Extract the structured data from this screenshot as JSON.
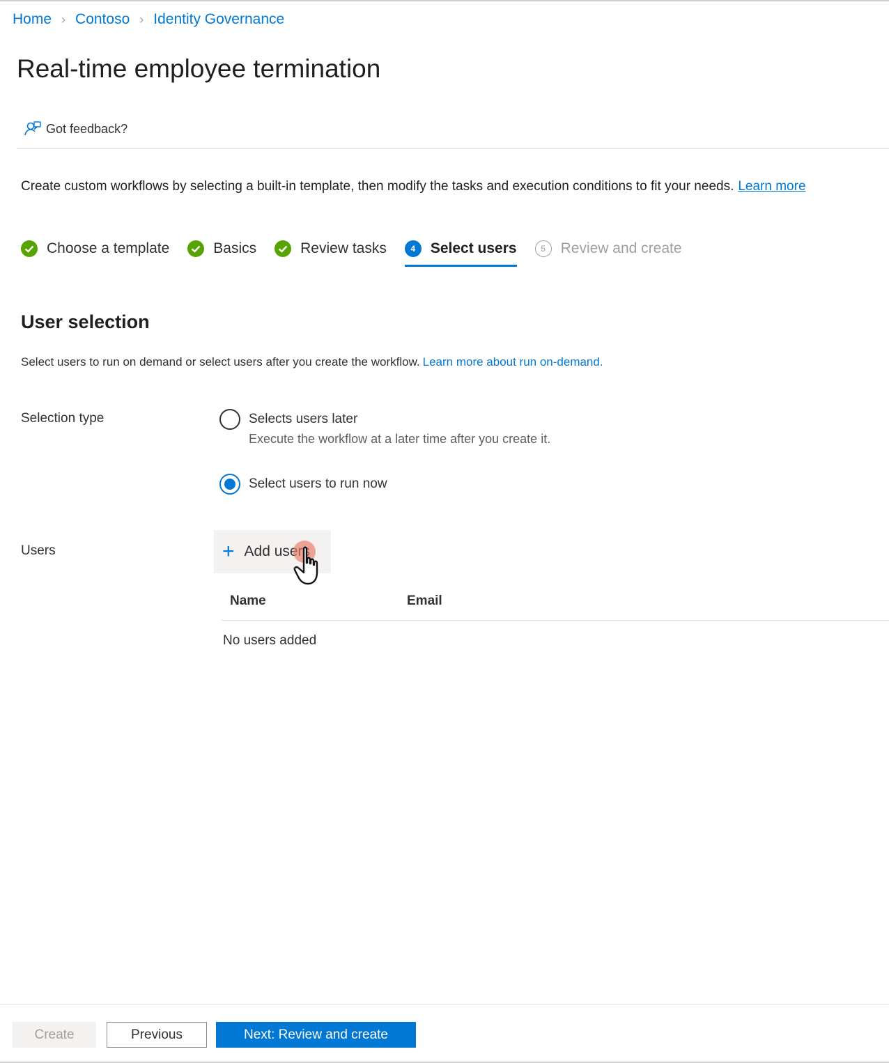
{
  "breadcrumb": {
    "items": [
      "Home",
      "Contoso",
      "Identity Governance"
    ]
  },
  "page": {
    "title": "Real-time employee termination"
  },
  "feedback": {
    "label": "Got feedback?"
  },
  "intro": {
    "text": "Create custom workflows by selecting a built-in template, then modify the tasks and execution conditions to fit your needs.",
    "link": "Learn more"
  },
  "steps": [
    {
      "label": "Choose a template",
      "state": "done"
    },
    {
      "label": "Basics",
      "state": "done"
    },
    {
      "label": "Review tasks",
      "state": "done"
    },
    {
      "label": "Select users",
      "state": "active",
      "number": "4"
    },
    {
      "label": "Review and create",
      "state": "pending",
      "number": "5"
    }
  ],
  "user_selection": {
    "title": "User selection",
    "description": "Select users to run on demand or select users after you create the workflow.",
    "link": "Learn more about run on-demand.",
    "selection_type_label": "Selection type",
    "options": [
      {
        "label": "Selects users later",
        "sublabel": "Execute the workflow at a later time after you create it.",
        "checked": false
      },
      {
        "label": "Select users to run now",
        "checked": true
      }
    ],
    "users_label": "Users",
    "add_users_label": "Add users",
    "columns": [
      "Name",
      "Email"
    ],
    "empty_text": "No users added"
  },
  "footer": {
    "create_label": "Create",
    "previous_label": "Previous",
    "next_label": "Next: Review and create"
  },
  "colors": {
    "accent": "#0078d4",
    "success": "#57a300",
    "text": "#323130",
    "muted": "#a19f9d"
  }
}
